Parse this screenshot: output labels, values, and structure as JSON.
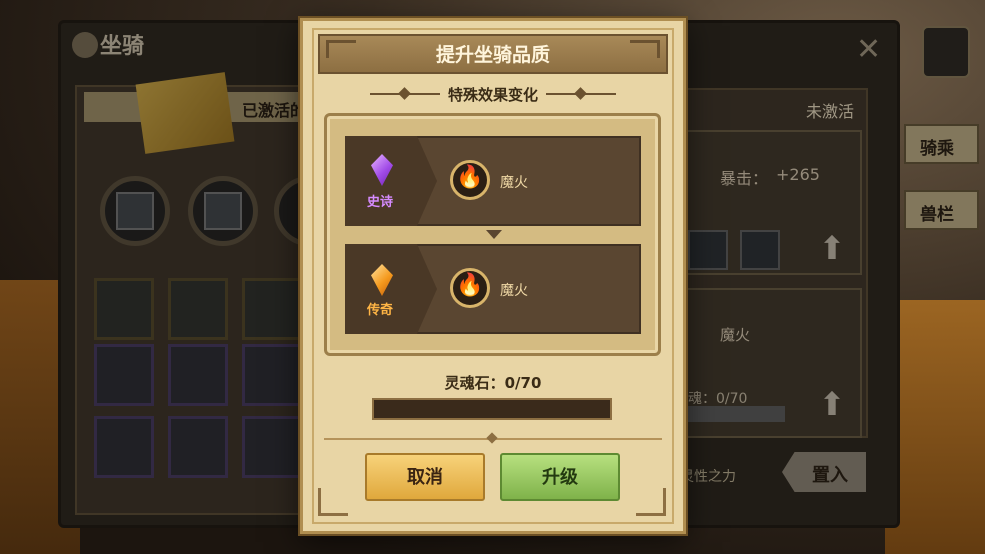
{
  "background_window": {
    "title": "坐骑",
    "left_header": "已激活的",
    "right_header": "未激活",
    "right_stat_label": "暴击：",
    "right_stat_value": "+265",
    "right_effect": "魔火",
    "right_soul": "魂：0/70",
    "right_trait": "灵性之力",
    "place_button": "置入"
  },
  "side_tabs": [
    {
      "label": "骑乘"
    },
    {
      "label": "兽栏"
    }
  ],
  "dialog": {
    "title": "提升坐骑品质",
    "subtitle": "特殊效果变化",
    "current": {
      "rarity": "史诗",
      "effect": "魔火",
      "rarity_color": "#d68bff"
    },
    "next": {
      "rarity": "传奇",
      "effect": "魔火",
      "rarity_color": "#ffb545"
    },
    "soul_stone_label": "灵魂石：0/70",
    "soul_stone_progress": 0,
    "cancel_label": "取消",
    "upgrade_label": "升级"
  },
  "icons": {
    "effect_icon": "fire-icon",
    "close_icon": "close-icon",
    "book_icon": "book-icon"
  }
}
